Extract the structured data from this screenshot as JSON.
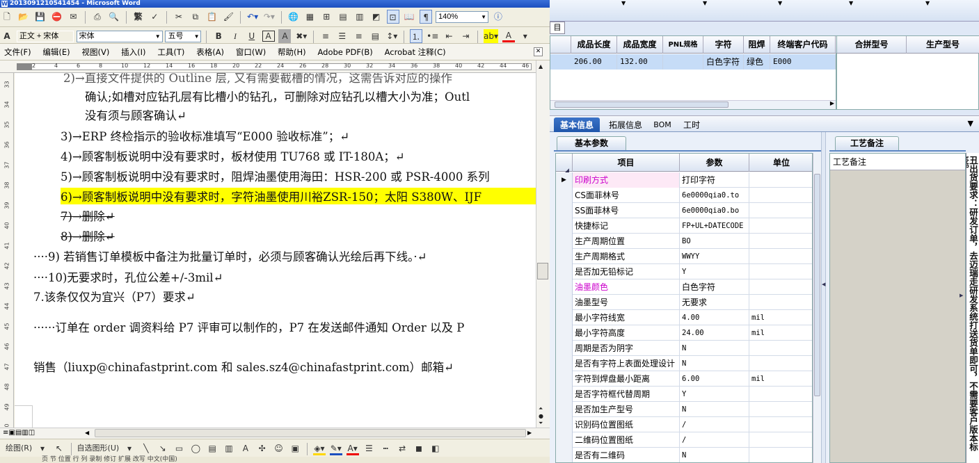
{
  "word": {
    "title": "2013091210541454 - Microsoft Word",
    "toolbar1": {
      "traditional_label": "繁",
      "zoom": "140%"
    },
    "toolbar2": {
      "style": "正文 + 宋体",
      "font": "宋体",
      "size": "五号",
      "bold": "B",
      "italic": "I",
      "underline": "U",
      "char_border": "A",
      "char_shade": "A",
      "font_color": "A"
    },
    "menus": [
      "文件(F)",
      "编辑(E)",
      "视图(V)",
      "插入(I)",
      "工具(T)",
      "表格(A)",
      "窗口(W)",
      "帮助(H)",
      "Adobe PDF(B)",
      "Acrobat 注释(C)"
    ],
    "ruler_numbers": [
      "2",
      "4",
      "6",
      "8",
      "10",
      "12",
      "14",
      "16",
      "18",
      "20",
      "22",
      "24",
      "26",
      "28",
      "30",
      "32",
      "34",
      "36",
      "38",
      "40",
      "42",
      "44",
      "46"
    ],
    "vruler_numbers": [
      "33",
      "34",
      "35",
      "36",
      "37",
      "38",
      "39",
      "40",
      "41",
      "42",
      "43",
      "44",
      "45",
      "46",
      "47",
      "48",
      "49",
      "50"
    ],
    "doc_lines": {
      "l1": "2)→直接文件提供的 Outline 层, 又有需要截槽的情况，这需告诉对应的操作",
      "l2": "确认;如槽对应钻孔层有比槽小的钻孔，可删除对应钻孔以槽大小为准；Outl",
      "l3": "没有须与顾客确认↵",
      "l4": "3)→ERP 终检指示的验收标准填写“E000 验收标准”；↵",
      "l5": "4)→顾客制板说明中没有要求时，板材使用 TU768 或 IT-180A；↵",
      "l6": "5)→顾客制板说明中没有要求时，阻焊油墨使用海田：HSR-200 或 PSR-4000 系列",
      "l7": "6)→顾客制板说明中没有要求时，字符油墨使用川裕ZSR-150；太阳 S380W、IJF",
      "l8": "7)→删除↵",
      "l9": "8)→删除↵",
      "l10": "····9) 若销售订单模板中备注为批量订单时，必须与顾客确认光绘后再下线。·↵",
      "l11": "····10)无要求时，孔位公差+/-3mil↵",
      "l12": "7.该条仅仅为宜兴（P7）要求↵",
      "l13": "······订单在 order 调资料给 P7 评审可以制作的，P7 在发送邮件通知 Order 以及 P",
      "l14": "销售（liuxp@chinafastprint.com 和 sales.sz4@chinafastprint.com）邮箱↵"
    },
    "drawbar": {
      "draw_label": "绘图(R)",
      "autoshape_label": "自选图形(U)"
    },
    "status_text": "页    节    位置    行    列    录制 修订 扩展 改写 中文(中国)"
  },
  "erp": {
    "top_tab": "目",
    "grid1": {
      "columns": [
        "成品长度",
        "成品宽度",
        "PNL规格",
        "字符",
        "阻焊",
        "终端客户代码"
      ],
      "row": [
        "206.00",
        "132.00",
        "",
        "白色字符",
        "绿色",
        "E000"
      ]
    },
    "grid2": {
      "columns": [
        "合拼型号",
        "生产型号"
      ]
    },
    "tabs": [
      "基本信息",
      "拓展信息",
      "BOM",
      "工时"
    ],
    "left_section": "基本参数",
    "param_headers": [
      "项目",
      "参数",
      "单位"
    ],
    "params": [
      {
        "item": "印刷方式",
        "value": "打印字符",
        "unit": "",
        "special": true
      },
      {
        "item": "CS面菲林号",
        "value": "6e0000qia0.to",
        "unit": ""
      },
      {
        "item": "SS面菲林号",
        "value": "6e0000qia0.bo",
        "unit": ""
      },
      {
        "item": "快捷标记",
        "value": "FP+UL+DATECODE",
        "unit": ""
      },
      {
        "item": "生产周期位置",
        "value": "BO",
        "unit": ""
      },
      {
        "item": "生产周期格式",
        "value": "WWYY",
        "unit": ""
      },
      {
        "item": "是否加无铅标记",
        "value": "Y",
        "unit": ""
      },
      {
        "item": "油墨颜色",
        "value": "白色字符",
        "unit": "",
        "special": true
      },
      {
        "item": "油墨型号",
        "value": "无要求",
        "unit": ""
      },
      {
        "item": "最小字符线宽",
        "value": "4.00",
        "unit": "mil"
      },
      {
        "item": "最小字符高度",
        "value": "24.00",
        "unit": "mil"
      },
      {
        "item": "周期是否为阴字",
        "value": "N",
        "unit": ""
      },
      {
        "item": "是否有字符上表面处理设计",
        "value": "N",
        "unit": ""
      },
      {
        "item": "字符到焊盘最小距离",
        "value": "6.00",
        "unit": "mil"
      },
      {
        "item": "是否字符框代替周期",
        "value": "Y",
        "unit": ""
      },
      {
        "item": "是否加生产型号",
        "value": "N",
        "unit": ""
      },
      {
        "item": "识别码位置图纸",
        "value": "/",
        "unit": ""
      },
      {
        "item": "二维码位置图纸",
        "value": "/",
        "unit": ""
      },
      {
        "item": "是否有二维码",
        "value": "N",
        "unit": ""
      }
    ],
    "right_section": "工艺备注",
    "remarks_header": "工艺备注",
    "side_text": "丑出货要求：研发订单，去迈瑞走研发系统打送货单即可，不需要客户版本标签。"
  },
  "colors": {
    "highlight": "#ffff00",
    "special_item": "#cc00cc",
    "selected_row": "#c6dcf7",
    "tab_active": "#1e55aa"
  }
}
